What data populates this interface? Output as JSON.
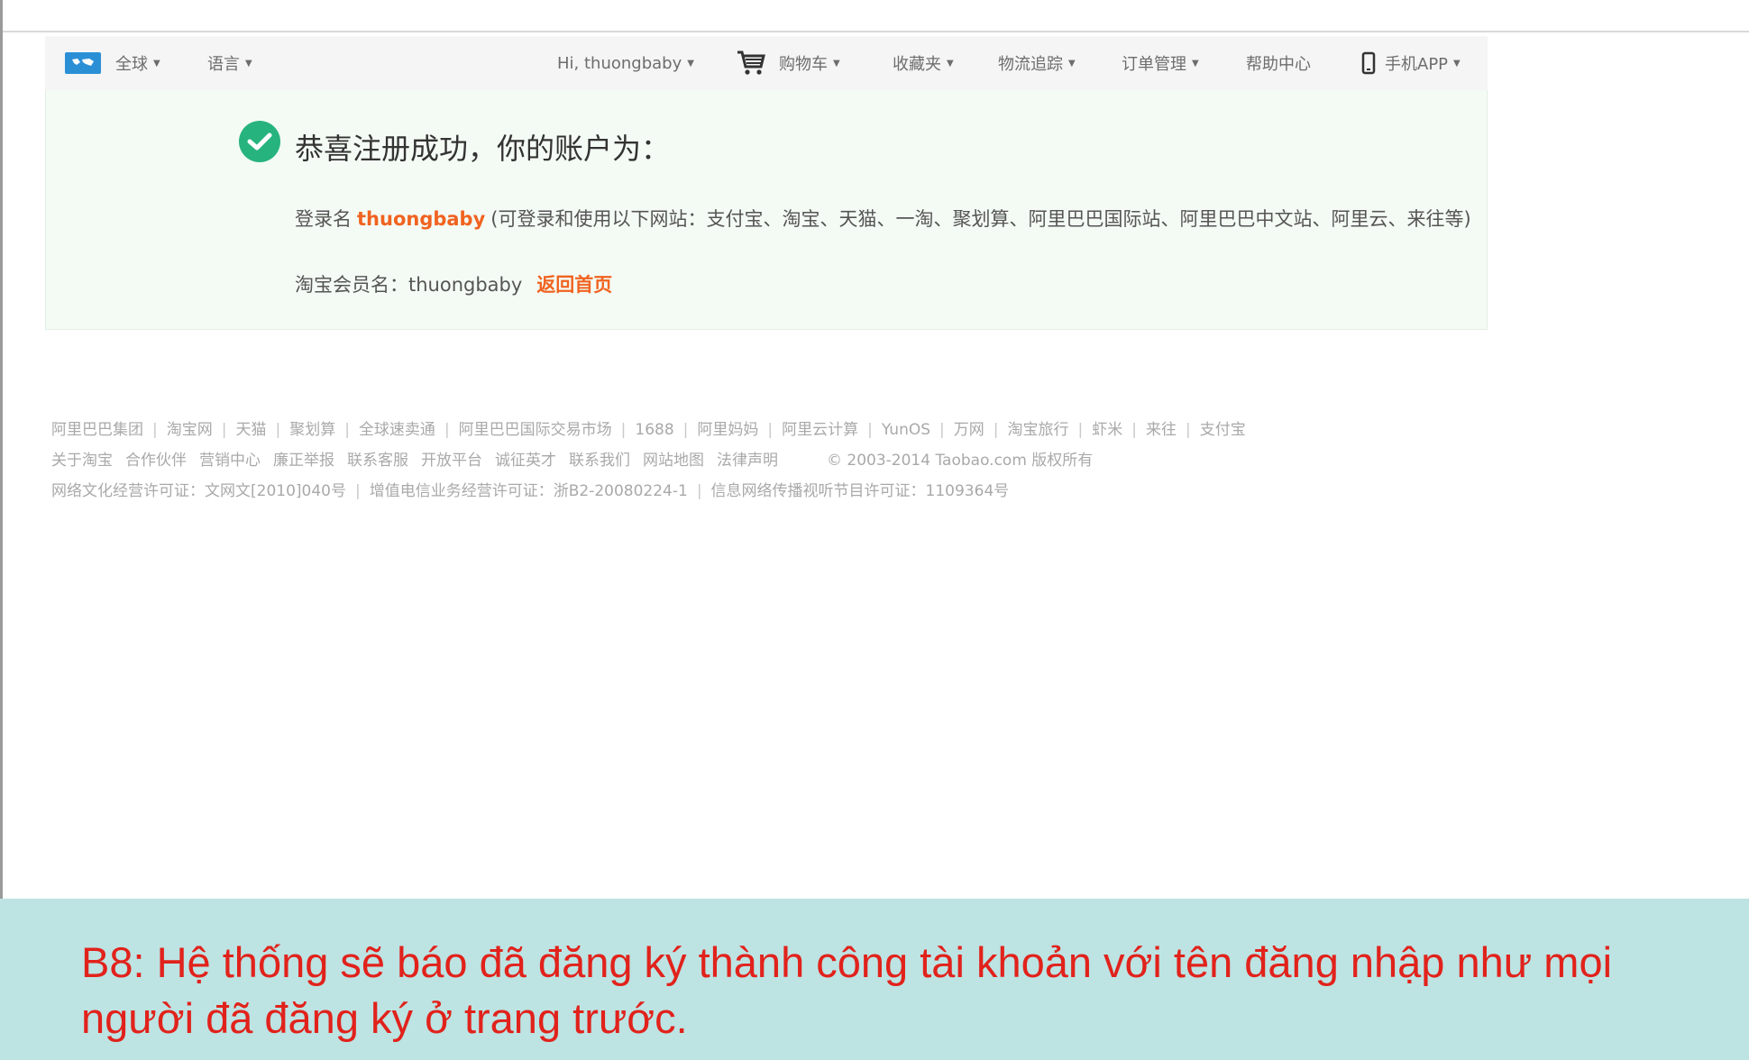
{
  "nav": {
    "global": "全球",
    "language": "语言",
    "greeting": "Hi, thuongbaby",
    "cart": "购物车",
    "favorites": "收藏夹",
    "logistics": "物流追踪",
    "orders": "订单管理",
    "help": "帮助中心",
    "mobile_app": "手机APP"
  },
  "success": {
    "title": "恭喜注册成功，你的账户为：",
    "login_label": "登录名",
    "username": "thuongbaby",
    "login_note": "(可登录和使用以下网站：支付宝、淘宝、天猫、一淘、聚划算、阿里巴巴国际站、阿里巴巴中文站、阿里云、来往等)",
    "member_label": "淘宝会员名：",
    "member_name": "thuongbaby",
    "home_link": "返回首页"
  },
  "footer": {
    "row1": [
      "阿里巴巴集团",
      "淘宝网",
      "天猫",
      "聚划算",
      "全球速卖通",
      "阿里巴巴国际交易市场",
      "1688",
      "阿里妈妈",
      "阿里云计算",
      "YunOS",
      "万网",
      "淘宝旅行",
      "虾米",
      "来往",
      "支付宝"
    ],
    "row2": [
      "关于淘宝",
      "合作伙伴",
      "营销中心",
      "廉正举报",
      "联系客服",
      "开放平台",
      "诚征英才",
      "联系我们",
      "网站地图",
      "法律声明"
    ],
    "copyright": "© 2003-2014 Taobao.com 版权所有",
    "license1": "网络文化经营许可证：文网文[2010]040号",
    "license2": "增值电信业务经营许可证：浙B2-20080224-1",
    "license3": "信息网络传播视听节目许可证：1109364号"
  },
  "caption": {
    "text": "B8: Hệ thống sẽ báo đã đăng ký thành công tài khoản với tên đăng nhập như mọi người đã đăng ký ở trang trước."
  },
  "colors": {
    "accent_orange": "#f06320",
    "success_green": "#27b37e",
    "caption_bg": "#bde3e3",
    "caption_text": "#e1221b"
  }
}
